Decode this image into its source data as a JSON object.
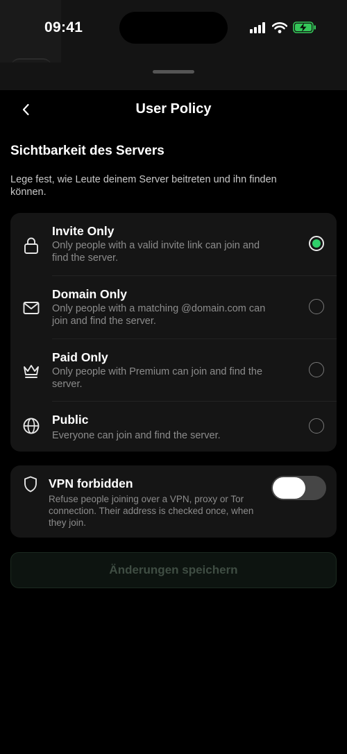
{
  "status_bar": {
    "time": "09:41"
  },
  "nav": {
    "title": "User Policy"
  },
  "visibility": {
    "title": "Sichtbarkeit des Servers",
    "description": "Lege fest, wie Leute deinem Server beitreten und ihn finden können.",
    "options": [
      {
        "label": "Invite Only",
        "description": "Only people with a valid invite link can join and find the server.",
        "icon": "lock-icon",
        "selected": true
      },
      {
        "label": "Domain Only",
        "description": "Only people with a matching @domain.com can join and find the server.",
        "icon": "envelope-icon",
        "selected": false
      },
      {
        "label": "Paid Only",
        "description": "Only people with Premium can join and find the server.",
        "icon": "crown-icon",
        "selected": false
      },
      {
        "label": "Public",
        "description": "Everyone can join and find the server.",
        "icon": "globe-icon",
        "selected": false
      }
    ]
  },
  "vpn": {
    "label": "VPN forbidden",
    "description": "Refuse people joining over a VPN, proxy or Tor connection. Their address is checked once, when they join.",
    "icon": "shield-icon",
    "enabled": false
  },
  "save_button": {
    "label": "Änderungen speichern",
    "enabled": false
  },
  "colors": {
    "accent": "#2fcf6a",
    "battery": "#34c759",
    "background": "#000000",
    "card": "#151515"
  }
}
